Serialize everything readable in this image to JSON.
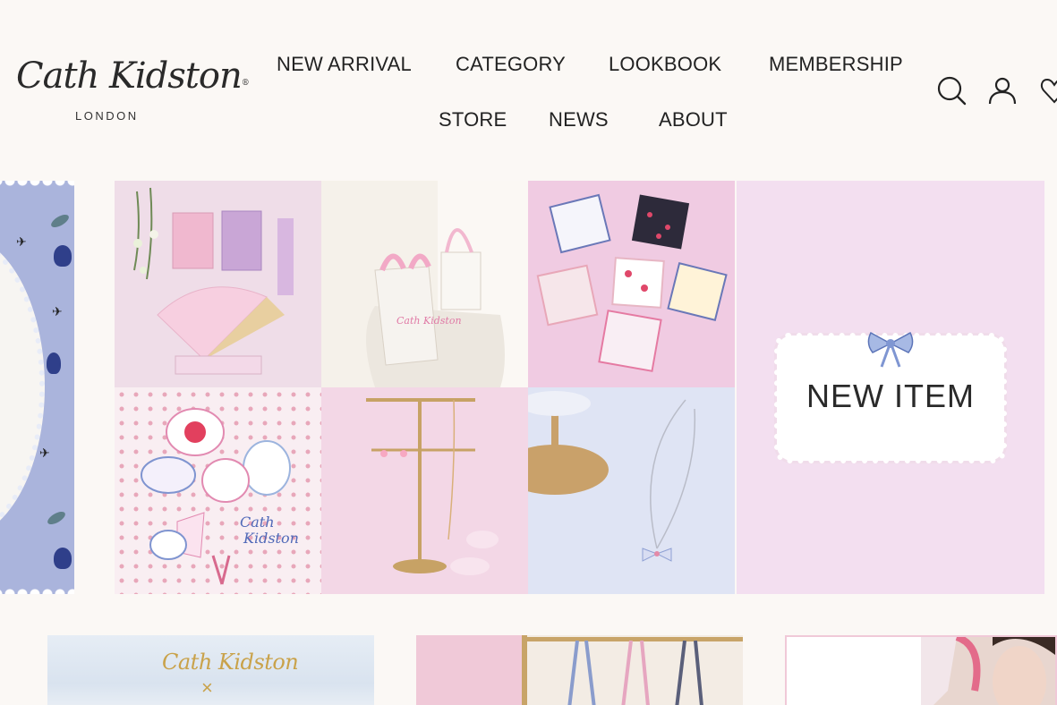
{
  "brand": {
    "logo_text": "Cath Kidston",
    "logo_reg": "®",
    "logo_sub": "LONDON"
  },
  "nav": {
    "row1": [
      "NEW ARRIVAL",
      "CATEGORY",
      "LOOKBOOK",
      "MEMBERSHIP"
    ],
    "row2": [
      "STORE",
      "NEWS",
      "ABOUT"
    ]
  },
  "header_icons": [
    "search-icon",
    "account-icon",
    "wishlist-icon"
  ],
  "hero": {
    "banner_label": "NEW ITEM",
    "tiles": [
      "stationery-and-fan",
      "tote-bag-on-chair",
      "handkerchiefs",
      "sticker-set",
      "earring-stand",
      "bow-necklace"
    ]
  },
  "promos": {
    "collab_logo": "Cath Kidston",
    "collab_x": "×"
  },
  "colors": {
    "background": "#fbf8f5",
    "pink_panel": "#f3dff0",
    "left_panel_blue": "#aab4dc",
    "gold": "#c9a24a"
  }
}
